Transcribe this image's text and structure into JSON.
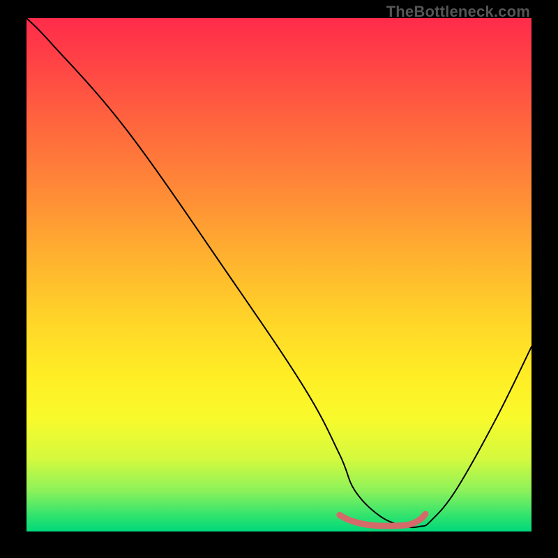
{
  "watermark": "TheBottleneck.com",
  "chart_data": {
    "type": "line",
    "title": "",
    "xlabel": "",
    "ylabel": "",
    "xlim": [
      0,
      100
    ],
    "ylim": [
      0,
      100
    ],
    "series": [
      {
        "name": "curve",
        "x": [
          0,
          5,
          20,
          40,
          55,
          62,
          65,
          70,
          75,
          78,
          80,
          85,
          93,
          100
        ],
        "y": [
          100,
          95,
          78,
          50,
          28,
          15,
          8,
          3,
          1,
          1,
          2,
          8,
          22,
          36
        ],
        "color": "#000000",
        "stroke_width": 2
      },
      {
        "name": "highlight",
        "x": [
          62,
          64,
          67,
          70,
          73,
          76,
          78,
          79
        ],
        "y": [
          3.2,
          2.2,
          1.4,
          1.1,
          1.1,
          1.4,
          2.4,
          3.4
        ],
        "color": "#d46a6a",
        "stroke_width": 9
      }
    ],
    "gradient_stops": [
      {
        "pos": 0.0,
        "color": "#ff2b4a"
      },
      {
        "pos": 0.5,
        "color": "#ffd828"
      },
      {
        "pos": 0.85,
        "color": "#d3f93e"
      },
      {
        "pos": 1.0,
        "color": "#00d87a"
      }
    ]
  }
}
